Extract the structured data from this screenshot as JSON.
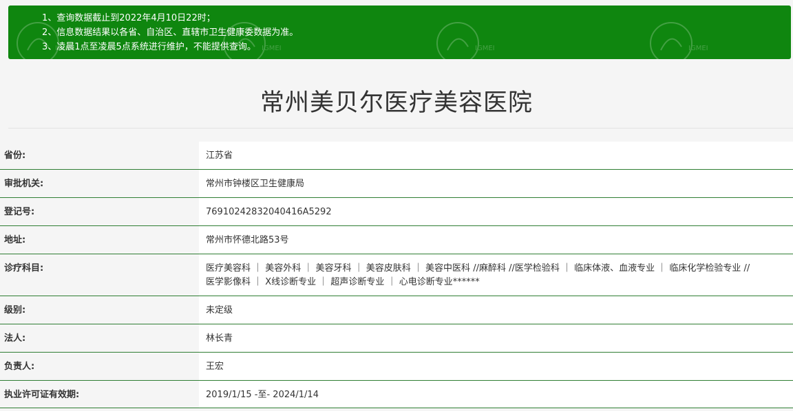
{
  "notice": {
    "lines": [
      "1、查询数据截止到2022年4月10日22时；",
      "2、信息数据结果以各省、自治区、直辖市卫生健康委数据为准。",
      "3、凌晨1点至凌晨5点系统进行维护，不能提供查询。"
    ],
    "watermark_text": "IGMEI"
  },
  "page_title": "常州美贝尔医疗美容医院",
  "rows": [
    {
      "label": "省份:",
      "value": "江苏省"
    },
    {
      "label": "审批机关:",
      "value": "常州市钟楼区卫生健康局"
    },
    {
      "label": "登记号:",
      "value": "76910242832040416A5292"
    },
    {
      "label": "地址:",
      "value": "常州市怀德北路53号"
    },
    {
      "label": "诊疗科目:",
      "value_lines": [
        "医疗美容科 ｜ 美容外科 ｜ 美容牙科 ｜ 美容皮肤科 ｜ 美容中医科 //麻醉科 //医学检验科 ｜ 临床体液、血液专业 ｜ 临床化学检验专业 //",
        "医学影像科 ｜ X线诊断专业 ｜ 超声诊断专业 ｜ 心电诊断专业******"
      ]
    },
    {
      "label": "级别:",
      "value": "未定级"
    },
    {
      "label": "法人:",
      "value": "林长青"
    },
    {
      "label": "负责人:",
      "value": "王宏"
    },
    {
      "label": "执业许可证有效期:",
      "value": "2019/1/15 -至- 2024/1/14"
    }
  ],
  "colors": {
    "notice_bg": "#0f860f",
    "row_border": "#2e7d32",
    "page_bg": "#f5f5f5"
  }
}
